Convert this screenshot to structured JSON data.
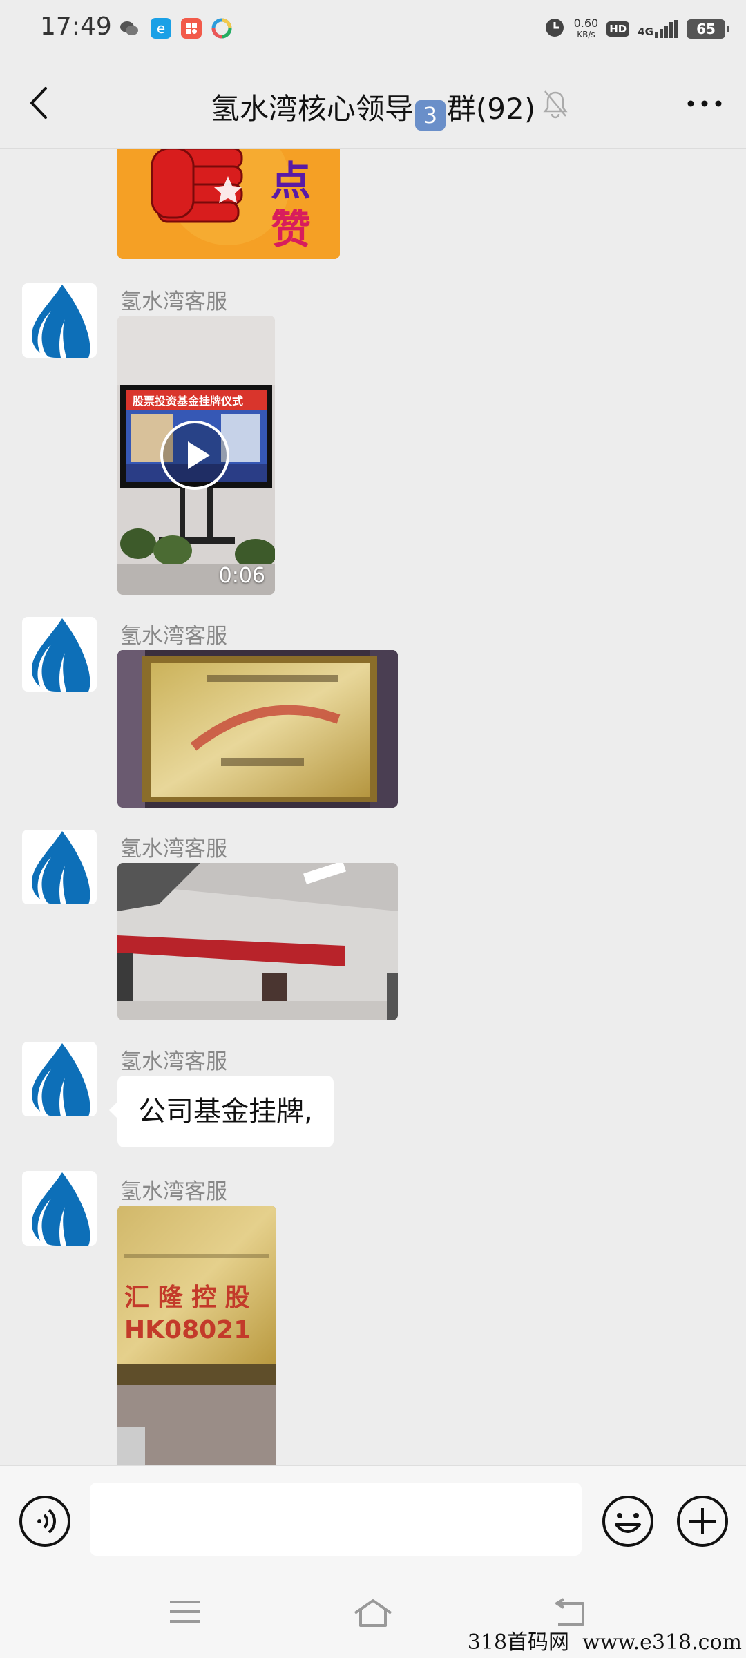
{
  "status_bar": {
    "time": "17:49",
    "net_speed_value": "0.60",
    "net_speed_unit": "KB/s",
    "hd": "HD",
    "signal": "4G",
    "battery": "65"
  },
  "header": {
    "title_prefix": "氢水湾核心领导",
    "title_badge": "3",
    "title_suffix": "群(92)"
  },
  "messages": [
    {
      "type": "image",
      "sticker_text_1": "点",
      "sticker_text_2": "赞"
    },
    {
      "type": "video",
      "sender": "氢水湾客服",
      "duration": "0:06",
      "banner_text": "股票投资基金挂牌仪式"
    },
    {
      "type": "image",
      "sender": "氢水湾客服"
    },
    {
      "type": "image",
      "sender": "氢水湾客服"
    },
    {
      "type": "text",
      "sender": "氢水湾客服",
      "text": "公司基金挂牌,"
    },
    {
      "type": "image",
      "sender": "氢水湾客服",
      "plaque_line_1": "汇 隆 控 股",
      "plaque_line_2": "HK08021"
    }
  ],
  "input": {
    "placeholder": ""
  },
  "watermark": "318首码网  www.e318.com",
  "colors": {
    "accent_blue": "#0d6fb8",
    "chat_bg": "#ededed",
    "bubble": "#ffffff"
  }
}
